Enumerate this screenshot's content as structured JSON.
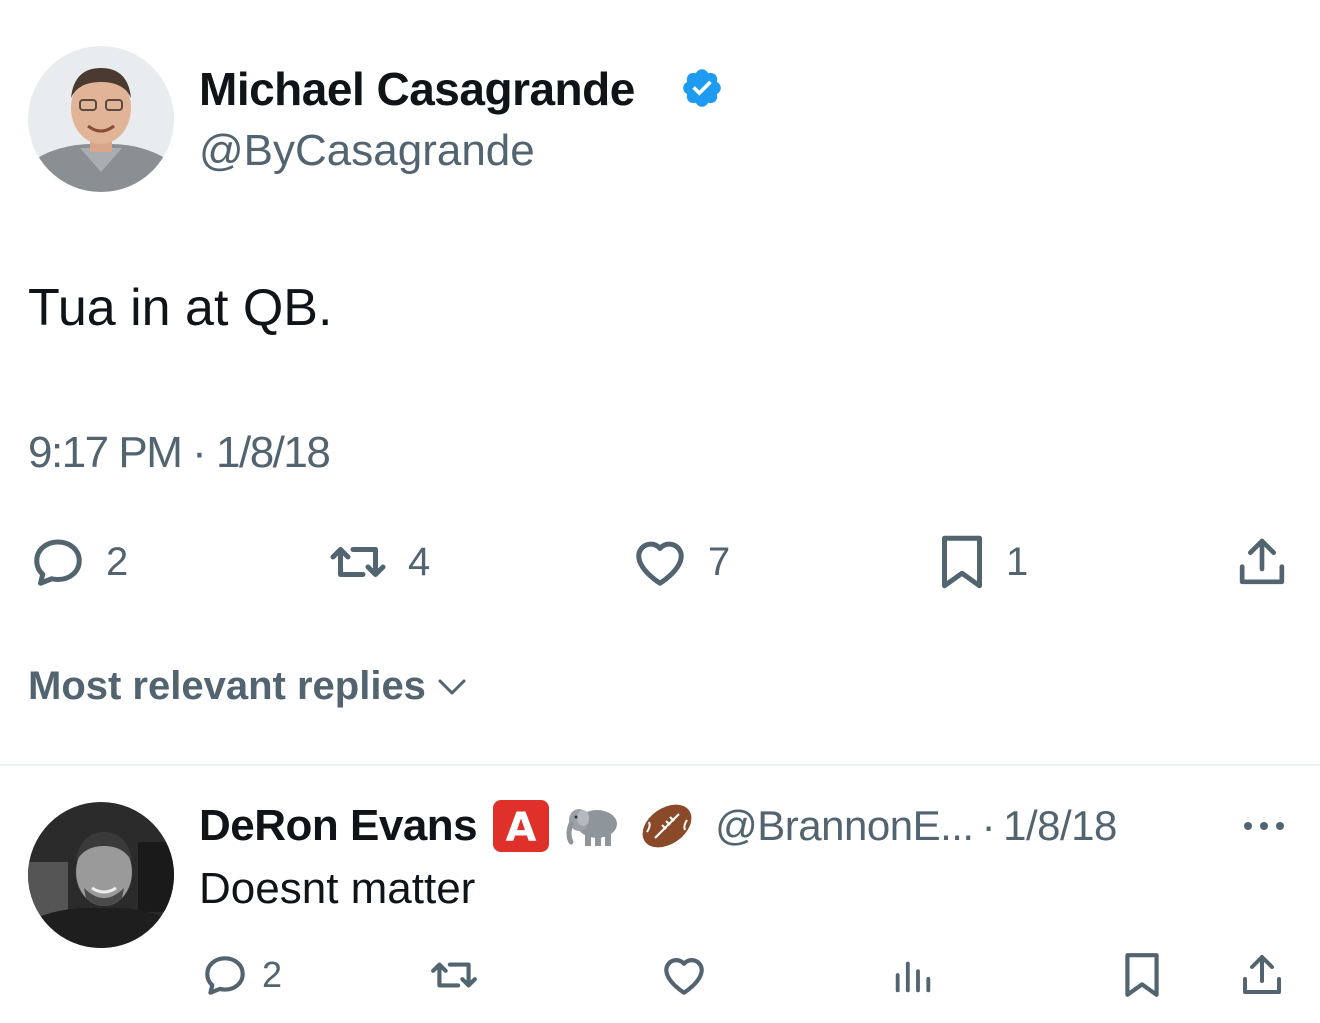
{
  "tweet": {
    "author_name": "Michael Casagrande",
    "author_handle": "@ByCasagrande",
    "verified_icon": "verified-badge-icon",
    "text": "Tua in at QB.",
    "time": "9:17 PM",
    "date": "1/8/18",
    "meta_separator": "·",
    "reply_count": "2",
    "retweet_count": "4",
    "like_count": "7",
    "bookmark_count": "1"
  },
  "replies_sort_label": "Most relevant replies",
  "reply": {
    "author_name": "DeRon Evans",
    "badges": [
      "🅰️",
      "🐘",
      "🏈"
    ],
    "badge_icons": [
      "letter-a-badge-icon",
      "elephant-icon",
      "football-icon"
    ],
    "author_handle": "@BrannonE...",
    "date": "1/8/18",
    "meta_separator": "·",
    "text": "Doesnt matter",
    "reply_count": "2"
  },
  "colors": {
    "text_primary": "#0f1419",
    "text_secondary": "#536471",
    "verified_blue": "#1d9bf0",
    "divider": "#eff3f4"
  }
}
